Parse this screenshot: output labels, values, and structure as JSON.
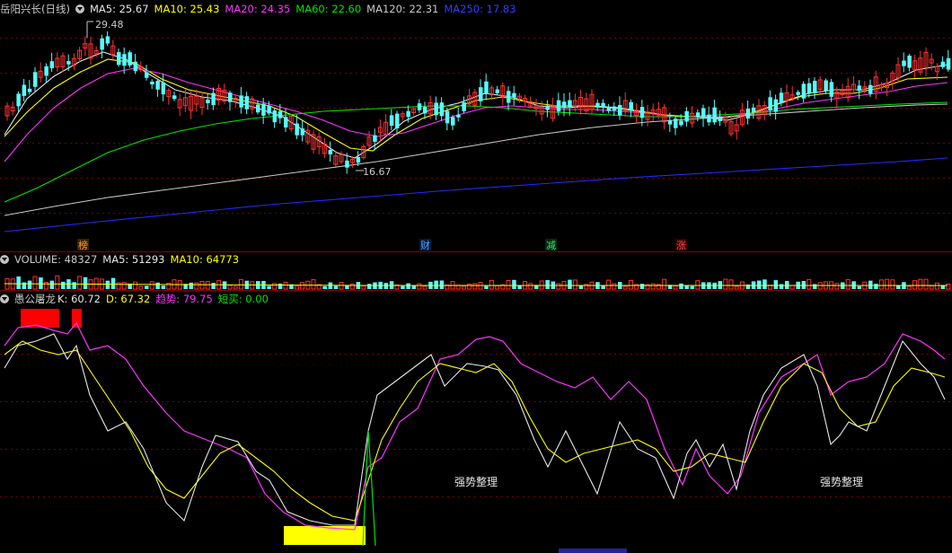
{
  "colors": {
    "up": "#ff3232",
    "down": "#54ffff",
    "ma5": "#e6e6e6",
    "ma10": "#ffff00",
    "ma20": "#ff33ff",
    "ma60": "#00e600",
    "ma120": "#c8c8c8",
    "ma250": "#2828ff",
    "grid": "#7a0000"
  },
  "price_panel": {
    "stock": "岳阳兴长(日线)",
    "ma": [
      {
        "label": "MA5: 25.67",
        "color": "#e6e6e6"
      },
      {
        "label": "MA10: 25.43",
        "color": "#ffff00"
      },
      {
        "label": "MA20: 24.35",
        "color": "#ff33ff"
      },
      {
        "label": "MA60: 22.60",
        "color": "#00e600"
      },
      {
        "label": "MA120: 22.31",
        "color": "#c8c8c8"
      },
      {
        "label": "MA250: 17.83",
        "color": "#2828ff"
      }
    ],
    "high_label": "29.48",
    "low_label": "16.67",
    "markers": [
      "榜",
      "财",
      "减",
      "涨"
    ]
  },
  "volume_panel": {
    "title": "VOLUME: 48327",
    "ma5": "MA5: 51293",
    "ma10": "MA10: 64773"
  },
  "indicator_panel": {
    "name": "愚公屠龙",
    "k": "K: 60.72",
    "d": "D: 67.32",
    "trend": "趋势: 79.75",
    "short_buy": "短买: 0.00",
    "annotations": [
      "强势整理",
      "强势整理"
    ]
  },
  "chart_data": {
    "type": "candlestick",
    "title": "岳阳兴长(日线)",
    "price_extremes": {
      "high": 29.48,
      "low": 16.67
    },
    "moving_averages": {
      "MA5": 25.67,
      "MA10": 25.43,
      "MA20": 24.35,
      "MA60": 22.6,
      "MA120": 22.31,
      "MA250": 17.83
    },
    "volume": {
      "VOLUME": 48327,
      "MA5": 51293,
      "MA10": 64773
    },
    "indicator": {
      "K": 60.72,
      "D": 67.32,
      "趋势": 79.75,
      "短买": 0.0
    }
  }
}
